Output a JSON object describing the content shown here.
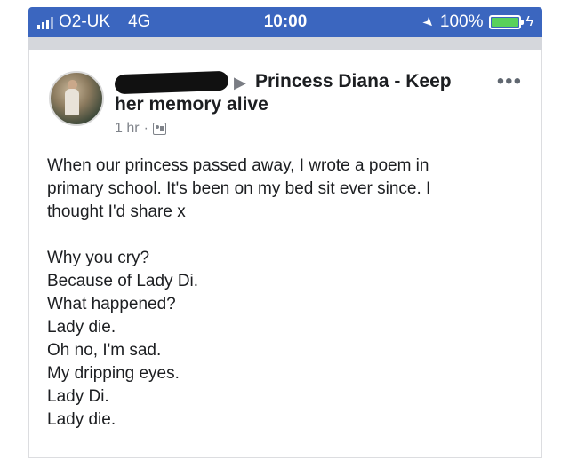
{
  "status_bar": {
    "carrier": "O2-UK",
    "network": "4G",
    "time": "10:00",
    "battery": "100%",
    "battery_level": 1.0,
    "accent_color": "#3b66bf"
  },
  "post": {
    "group_name_line1": "Princess Diana - Keep",
    "group_name_line2": "her memory alive",
    "timestamp": "1 hr",
    "intro_lines": [
      "When our princess passed away, I wrote a poem in",
      "primary school. It's been on my bed sit ever since. I",
      "thought I'd share x"
    ],
    "poem_lines": [
      "Why you cry?",
      "Because of Lady Di.",
      "What happened?",
      "Lady die.",
      "Oh no, I'm sad.",
      "My dripping eyes.",
      "Lady Di.",
      "Lady die."
    ]
  },
  "icons": {
    "more": "more-options-icon",
    "arrow": "shared-to-arrow-icon",
    "audience": "group-audience-icon",
    "location_arrow": "location-arrow-icon"
  }
}
